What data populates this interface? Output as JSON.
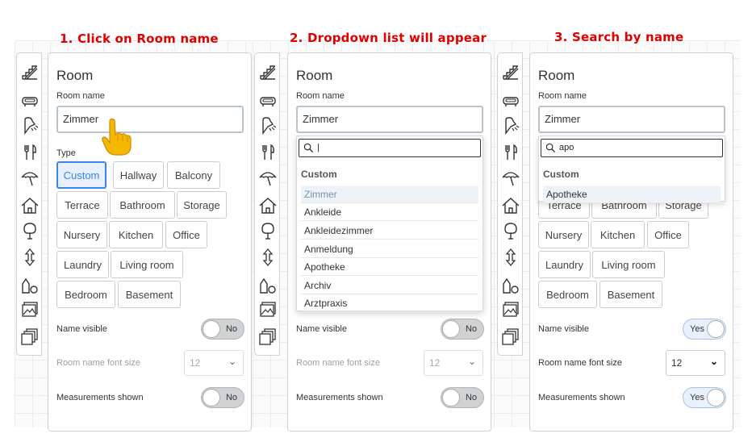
{
  "steps": [
    {
      "title": "1. Click on Room name"
    },
    {
      "title": "2. Dropdown list will appear"
    },
    {
      "title": "3. Search by name"
    }
  ],
  "toolbar_icons": [
    "stairs-icon",
    "bathtub-icon",
    "shower-icon",
    "cutlery-icon",
    "umbrella-icon",
    "house-icon",
    "tree-icon",
    "vertical-arrows-icon",
    "shapes-icon",
    "picture-icon",
    "layers-icon"
  ],
  "panel": {
    "title": "Room",
    "room_name_label": "Room name",
    "room_name_value": "Zimmer",
    "type_label": "Type",
    "types": [
      "Custom",
      "Hallway",
      "Balcony",
      "Terrace",
      "Bathroom",
      "Storage",
      "Nursery",
      "Kitchen",
      "Office",
      "Laundry",
      "Living room",
      "Bedroom",
      "Basement"
    ],
    "name_visible_label": "Name visible",
    "font_size_label": "Room name font size",
    "font_size_value": "12",
    "measurements_label": "Measurements shown",
    "toggle_no": "No",
    "toggle_yes": "Yes"
  },
  "dropdown1": {
    "search_value": "|",
    "group": "Custom",
    "items": [
      "Zimmer",
      "Ankleide",
      "Ankleidezimmer",
      "Anmeldung",
      "Apotheke",
      "Archiv",
      "Arztpraxis"
    ]
  },
  "dropdown2": {
    "search_value": "apo",
    "group": "Custom",
    "items": [
      "Apotheke"
    ]
  },
  "colors": {
    "accent": "#3b82f6",
    "step_title": "#e00000",
    "cursor": "#f5b800"
  }
}
